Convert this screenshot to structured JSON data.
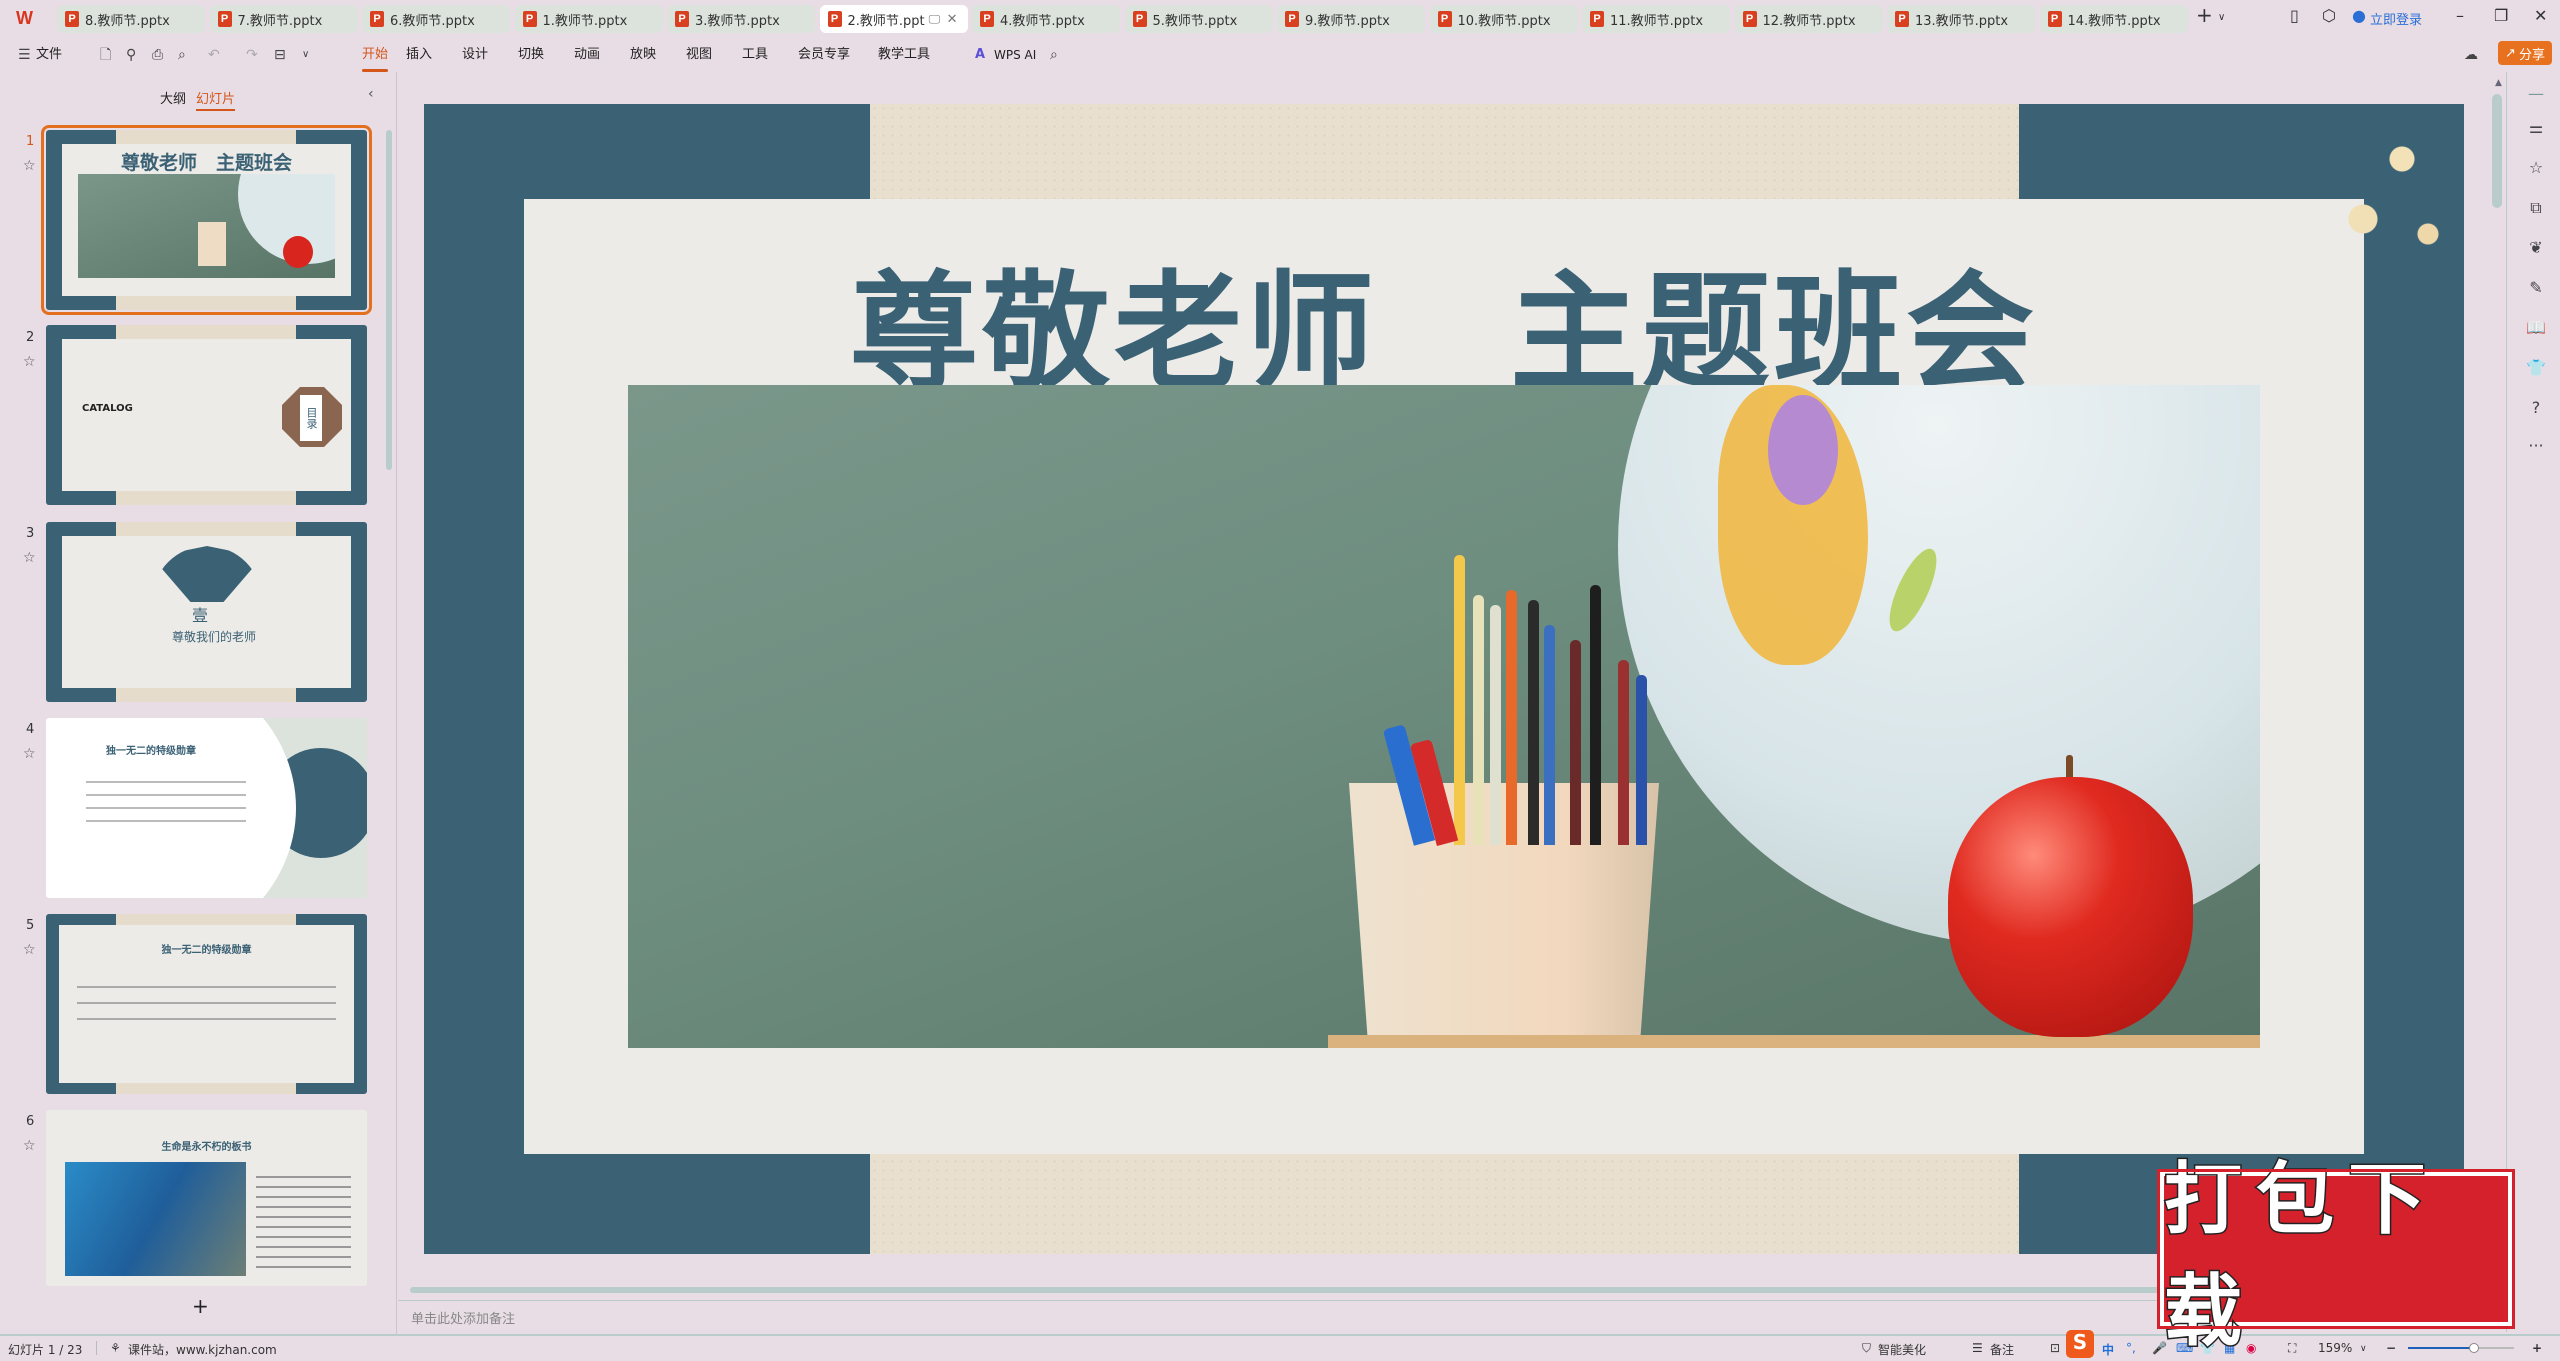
{
  "app": {
    "logo": "W"
  },
  "tabs": [
    {
      "label": "8.教师节.pptx"
    },
    {
      "label": "7.教师节.pptx"
    },
    {
      "label": "6.教师节.pptx"
    },
    {
      "label": "1.教师节.pptx"
    },
    {
      "label": "3.教师节.pptx"
    },
    {
      "label": "2.教师节.ppt",
      "active": true
    },
    {
      "label": "4.教师节.pptx"
    },
    {
      "label": "5.教师节.pptx"
    },
    {
      "label": "9.教师节.pptx"
    },
    {
      "label": "10.教师节.pptx"
    },
    {
      "label": "11.教师节.pptx"
    },
    {
      "label": "12.教师节.pptx"
    },
    {
      "label": "13.教师节.pptx"
    },
    {
      "label": "14.教师节.pptx"
    }
  ],
  "titlebar": {
    "new_tab": "+",
    "login": "立即登录",
    "minimize": "–",
    "maximize": "❐",
    "close": "✕"
  },
  "toolbar": {
    "file": "文件",
    "menus": [
      "开始",
      "插入",
      "设计",
      "切换",
      "动画",
      "放映",
      "视图",
      "工具",
      "会员专享",
      "教学工具"
    ],
    "active": "开始",
    "wps_ai": "WPS AI",
    "share": "分享"
  },
  "panel": {
    "outline_tab": "大纲",
    "slides_tab": "幻灯片",
    "add": "+"
  },
  "thumbnails": [
    {
      "num": "1",
      "title": "尊敬老师　主题班会"
    },
    {
      "num": "2",
      "catalog": "CATALOG",
      "menu": "目录"
    },
    {
      "num": "3",
      "numeral": "壹",
      "subtitle": "尊敬我们的老师"
    },
    {
      "num": "4",
      "title": "独一无二的特级勋章"
    },
    {
      "num": "5",
      "title": "独一无二的特级勋章"
    },
    {
      "num": "6",
      "title": "生命是永不朽的板书"
    }
  ],
  "slide": {
    "title": "尊敬老师　主题班会",
    "primary_color": "#3b6175"
  },
  "notes": {
    "placeholder": "单击此处添加备注"
  },
  "status": {
    "slide_counter": "幻灯片 1 / 23",
    "site": "课件站，www.kjzhan.com",
    "beautify": "智能美化",
    "notes": "备注",
    "ime": "中",
    "zoom": "159%",
    "zoom_percent": 159
  },
  "watermark": {
    "text": "打包下载"
  },
  "colors": {
    "accent": "#d4561a",
    "share": "#e8711f",
    "background": "#e8dde5"
  }
}
